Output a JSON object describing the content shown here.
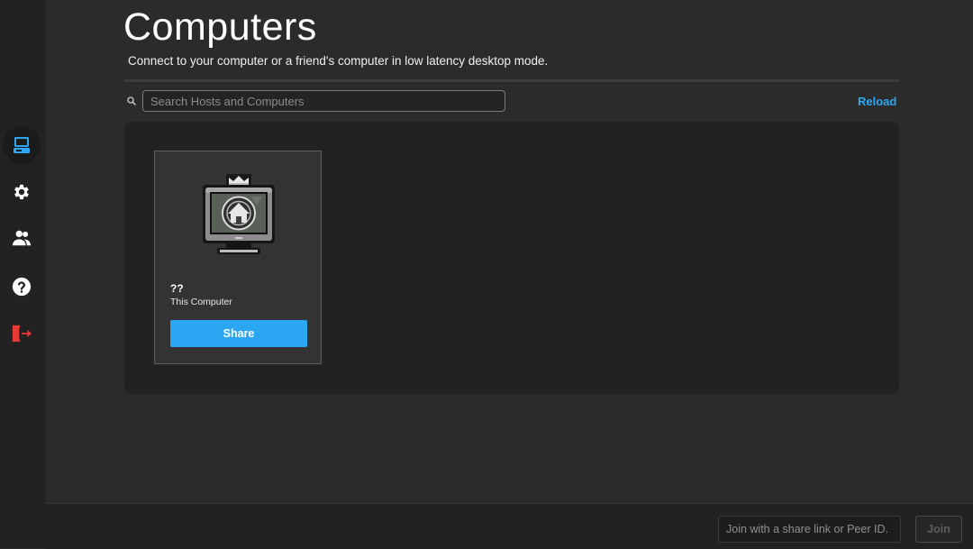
{
  "page": {
    "title": "Computers",
    "subtitle": "Connect to your computer or a friend's computer in low latency desktop mode."
  },
  "sidebar": {
    "items": [
      {
        "id": "computers",
        "icon": "computer-icon",
        "active": true,
        "color": "#2fa6f0"
      },
      {
        "id": "settings",
        "icon": "gear-icon",
        "active": false,
        "color": "#ffffff"
      },
      {
        "id": "friends",
        "icon": "users-icon",
        "active": false,
        "color": "#ffffff"
      },
      {
        "id": "help",
        "icon": "help-icon",
        "active": false,
        "color": "#ffffff"
      },
      {
        "id": "logout",
        "icon": "logout-icon",
        "active": false,
        "color": "#e53935"
      }
    ]
  },
  "search": {
    "placeholder": "Search Hosts and Computers",
    "value": ""
  },
  "toolbar": {
    "reload_label": "Reload"
  },
  "computers": [
    {
      "name": "??",
      "subtitle": "This Computer",
      "action_label": "Share",
      "icon": "home-computer-icon"
    }
  ],
  "footer": {
    "join_placeholder": "Join with a share link or Peer ID.",
    "join_value": "",
    "join_label": "Join"
  },
  "colors": {
    "accent": "#2aa6f2",
    "danger": "#e53935",
    "background": "#2b2b2b",
    "panel": "#222222"
  }
}
